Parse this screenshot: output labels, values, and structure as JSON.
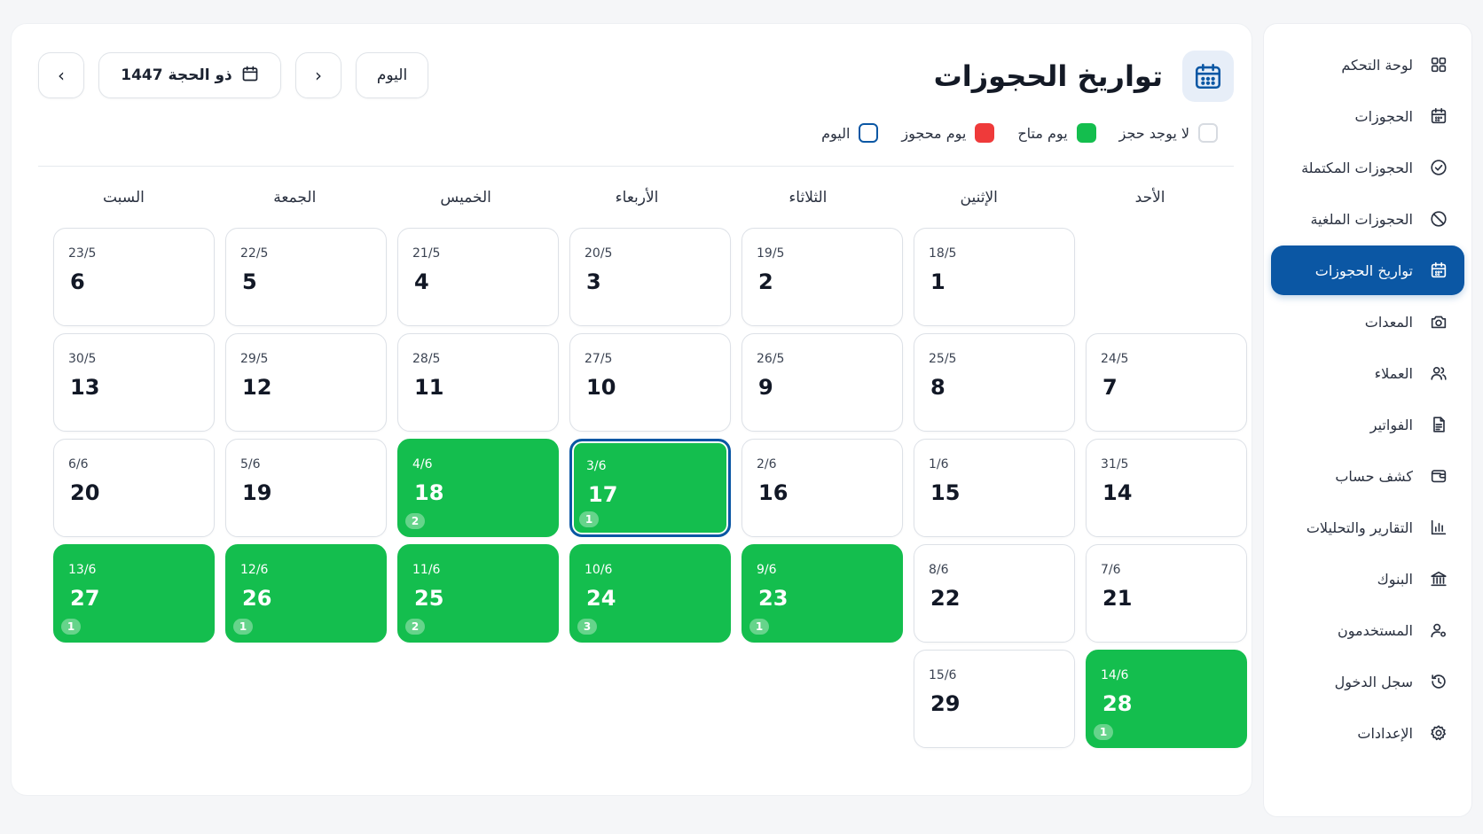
{
  "page_title": "تواريخ الحجوزات",
  "toolbar": {
    "today_label": "اليوم",
    "month_label": "ذو الحجة 1447",
    "next_arrow": "›",
    "prev_arrow": "‹"
  },
  "legend": [
    {
      "label": "لا يوجد حجز",
      "color": "#ffffff"
    },
    {
      "label": "يوم متاح",
      "color": "#14be4e"
    },
    {
      "label": "يوم محجوز",
      "color": "#ef3a3a"
    },
    {
      "label": "اليوم",
      "color": "#0b57a4"
    }
  ],
  "weekdays": [
    "الأحد",
    "الإثنين",
    "الثلاثاء",
    "الأربعاء",
    "الخميس",
    "الجمعة",
    "السبت"
  ],
  "days": [
    {
      "hijri": "",
      "greg": "",
      "status": "empty",
      "count": ""
    },
    {
      "hijri": "1",
      "greg": "18/5",
      "status": "none",
      "count": ""
    },
    {
      "hijri": "2",
      "greg": "19/5",
      "status": "none",
      "count": ""
    },
    {
      "hijri": "3",
      "greg": "20/5",
      "status": "none",
      "count": ""
    },
    {
      "hijri": "4",
      "greg": "21/5",
      "status": "none",
      "count": ""
    },
    {
      "hijri": "5",
      "greg": "22/5",
      "status": "none",
      "count": ""
    },
    {
      "hijri": "6",
      "greg": "23/5",
      "status": "none",
      "count": ""
    },
    {
      "hijri": "7",
      "greg": "24/5",
      "status": "none",
      "count": ""
    },
    {
      "hijri": "8",
      "greg": "25/5",
      "status": "none",
      "count": ""
    },
    {
      "hijri": "9",
      "greg": "26/5",
      "status": "none",
      "count": ""
    },
    {
      "hijri": "10",
      "greg": "27/5",
      "status": "none",
      "count": ""
    },
    {
      "hijri": "11",
      "greg": "28/5",
      "status": "none",
      "count": ""
    },
    {
      "hijri": "12",
      "greg": "29/5",
      "status": "none",
      "count": ""
    },
    {
      "hijri": "13",
      "greg": "30/5",
      "status": "none",
      "count": ""
    },
    {
      "hijri": "14",
      "greg": "31/5",
      "status": "none",
      "count": ""
    },
    {
      "hijri": "15",
      "greg": "1/6",
      "status": "none",
      "count": ""
    },
    {
      "hijri": "16",
      "greg": "2/6",
      "status": "none",
      "count": ""
    },
    {
      "hijri": "17",
      "greg": "3/6",
      "status": "free",
      "count": "1",
      "today": true
    },
    {
      "hijri": "18",
      "greg": "4/6",
      "status": "free",
      "count": "2"
    },
    {
      "hijri": "19",
      "greg": "5/6",
      "status": "none",
      "count": ""
    },
    {
      "hijri": "20",
      "greg": "6/6",
      "status": "none",
      "count": ""
    },
    {
      "hijri": "21",
      "greg": "7/6",
      "status": "none",
      "count": ""
    },
    {
      "hijri": "22",
      "greg": "8/6",
      "status": "none",
      "count": ""
    },
    {
      "hijri": "23",
      "greg": "9/6",
      "status": "free",
      "count": "1"
    },
    {
      "hijri": "24",
      "greg": "10/6",
      "status": "free",
      "count": "3"
    },
    {
      "hijri": "25",
      "greg": "11/6",
      "status": "free",
      "count": "2"
    },
    {
      "hijri": "26",
      "greg": "12/6",
      "status": "free",
      "count": "1"
    },
    {
      "hijri": "27",
      "greg": "13/6",
      "status": "free",
      "count": "1"
    },
    {
      "hijri": "28",
      "greg": "14/6",
      "status": "free",
      "count": "1"
    },
    {
      "hijri": "29",
      "greg": "15/6",
      "status": "none",
      "count": ""
    }
  ],
  "sidebar": {
    "items": [
      {
        "label": "لوحة التحكم",
        "icon": "dashboard-icon",
        "active": false
      },
      {
        "label": "الحجوزات",
        "icon": "calendar-icon",
        "active": false
      },
      {
        "label": "الحجوزات المكتملة",
        "icon": "check-circle-icon",
        "active": false
      },
      {
        "label": "الحجوزات الملغية",
        "icon": "ban-icon",
        "active": false
      },
      {
        "label": "تواريخ الحجوزات",
        "icon": "calendar-icon",
        "active": true
      },
      {
        "label": "المعدات",
        "icon": "camera-icon",
        "active": false
      },
      {
        "label": "العملاء",
        "icon": "users-icon",
        "active": false
      },
      {
        "label": "الفواتير",
        "icon": "invoice-icon",
        "active": false
      },
      {
        "label": "كشف حساب",
        "icon": "wallet-icon",
        "active": false
      },
      {
        "label": "التقارير والتحليلات",
        "icon": "bar-chart-icon",
        "active": false
      },
      {
        "label": "البنوك",
        "icon": "bank-icon",
        "active": false
      },
      {
        "label": "المستخدمون",
        "icon": "user-gear-icon",
        "active": false
      },
      {
        "label": "سجل الدخول",
        "icon": "history-icon",
        "active": false
      },
      {
        "label": "الإعدادات",
        "icon": "settings-icon",
        "active": false
      }
    ]
  }
}
